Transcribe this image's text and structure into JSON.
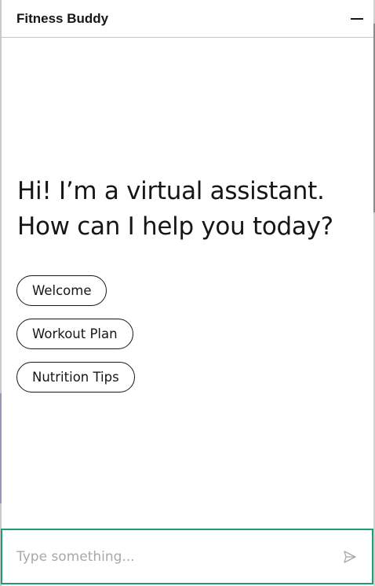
{
  "header": {
    "title": "Fitness Buddy"
  },
  "greeting": {
    "line1": "Hi! I’m a virtual assistant.",
    "line2": "How can I help you today?"
  },
  "quick_replies": [
    {
      "label": "Welcome"
    },
    {
      "label": "Workout Plan"
    },
    {
      "label": "Nutrition Tips"
    }
  ],
  "composer": {
    "value": "",
    "placeholder": "Type something..."
  },
  "icons": {
    "minimize": "minimize-icon",
    "send": "send-icon"
  },
  "colors": {
    "text": "#161616",
    "input_border": "#1f9e6f",
    "placeholder": "#a8a8a8",
    "divider": "#c6c6c6"
  }
}
